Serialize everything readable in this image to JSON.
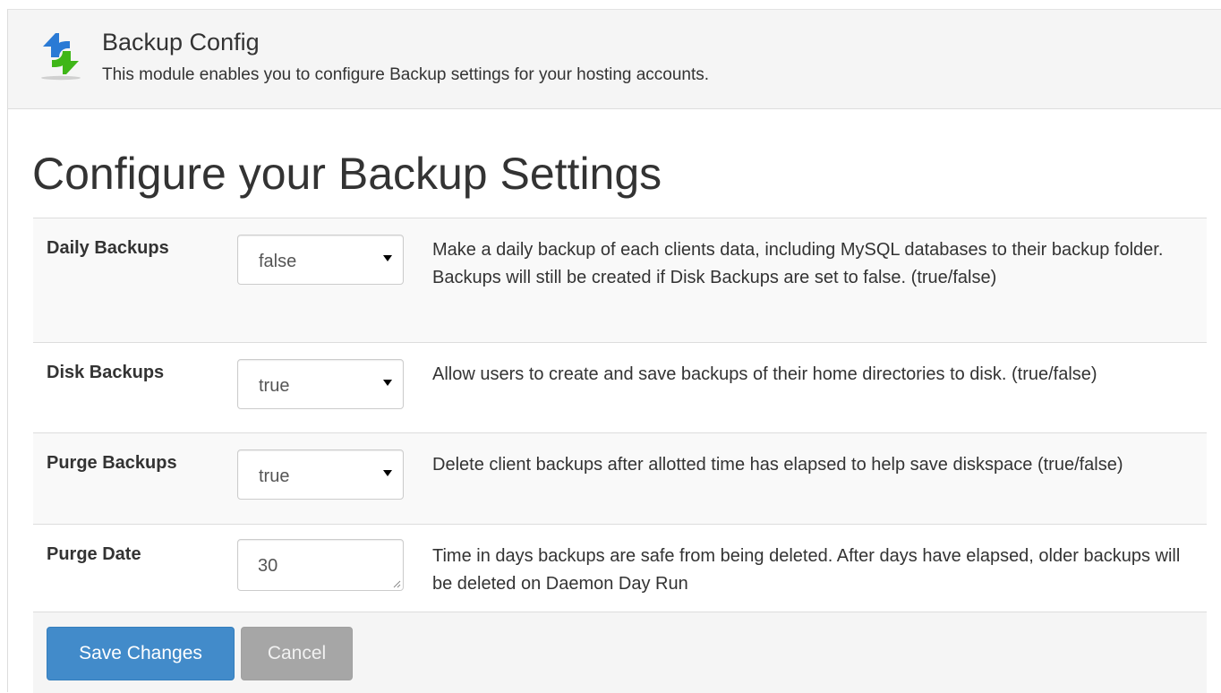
{
  "module": {
    "icon": "backup-sync-icon",
    "title": "Backup Config",
    "subtitle": "This module enables you to configure Backup settings for your hosting accounts."
  },
  "page_title": "Configure your Backup Settings",
  "settings": [
    {
      "label": "Daily Backups",
      "control": "select",
      "value": "false",
      "description": "Make a daily backup of each clients data, including MySQL databases to their backup folder. Backups will still be created if Disk Backups are set to false. (true/false)"
    },
    {
      "label": "Disk Backups",
      "control": "select",
      "value": "true",
      "description": "Allow users to create and save backups of their home directories to disk. (true/false)"
    },
    {
      "label": "Purge Backups",
      "control": "select",
      "value": "true",
      "description": "Delete client backups after allotted time has elapsed to help save diskspace (true/false)"
    },
    {
      "label": "Purge Date",
      "control": "textarea",
      "value": "30",
      "description": "Time in days backups are safe from being deleted. After days have elapsed, older backups will be deleted on Daemon Day Run"
    }
  ],
  "actions": {
    "save_label": "Save Changes",
    "cancel_label": "Cancel"
  },
  "colors": {
    "primary_button": "#428bca",
    "cancel_button": "#a6a6a6",
    "icon_blue": "#2a7ad5",
    "icon_green": "#3fb618"
  }
}
